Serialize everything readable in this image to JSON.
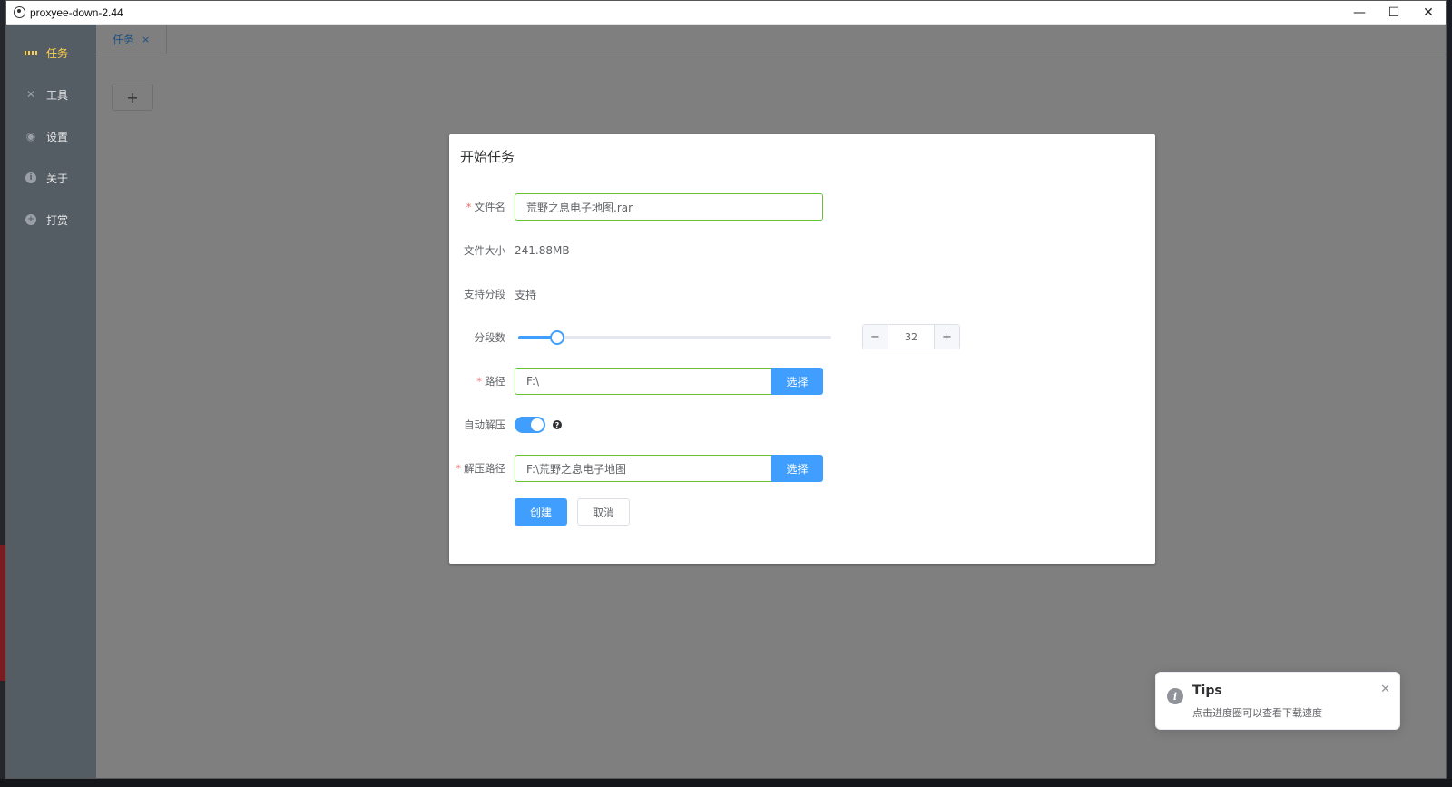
{
  "window": {
    "title": "proxyee-down-2.44",
    "minimize": "—",
    "maximize": "☐",
    "close": "✕"
  },
  "sidebar": {
    "items": [
      {
        "label": "任务",
        "icon": "grid-icon",
        "active": true
      },
      {
        "label": "工具",
        "icon": "tools-icon"
      },
      {
        "label": "设置",
        "icon": "settings-icon"
      },
      {
        "label": "关于",
        "icon": "info-icon"
      },
      {
        "label": "打赏",
        "icon": "plus-circle-icon"
      }
    ]
  },
  "tabs": [
    {
      "label": "任务",
      "close": "×"
    }
  ],
  "add_button": "+",
  "dialog": {
    "title": "开始任务",
    "fields": {
      "filename": {
        "label": "文件名",
        "required": "*",
        "value": "荒野之息电子地图.rar"
      },
      "filesize": {
        "label": "文件大小",
        "value": "241.88MB"
      },
      "segment_support": {
        "label": "支持分段",
        "value": "支持"
      },
      "segments": {
        "label": "分段数",
        "value": "32",
        "slider_fraction": 0.125,
        "minus": "−",
        "plus": "+"
      },
      "path": {
        "label": "路径",
        "required": "*",
        "value": "F:\\",
        "button": "选择"
      },
      "auto_unzip": {
        "label": "自动解压",
        "on": true,
        "help": "?"
      },
      "unzip_path": {
        "label": "解压路径",
        "required": "*",
        "value": "F:\\荒野之息电子地图",
        "button": "选择"
      }
    },
    "buttons": {
      "create": "创建",
      "cancel": "取消"
    }
  },
  "notification": {
    "icon": "i",
    "title": "Tips",
    "message": "点击进度圈可以查看下载速度",
    "close": "✕"
  }
}
